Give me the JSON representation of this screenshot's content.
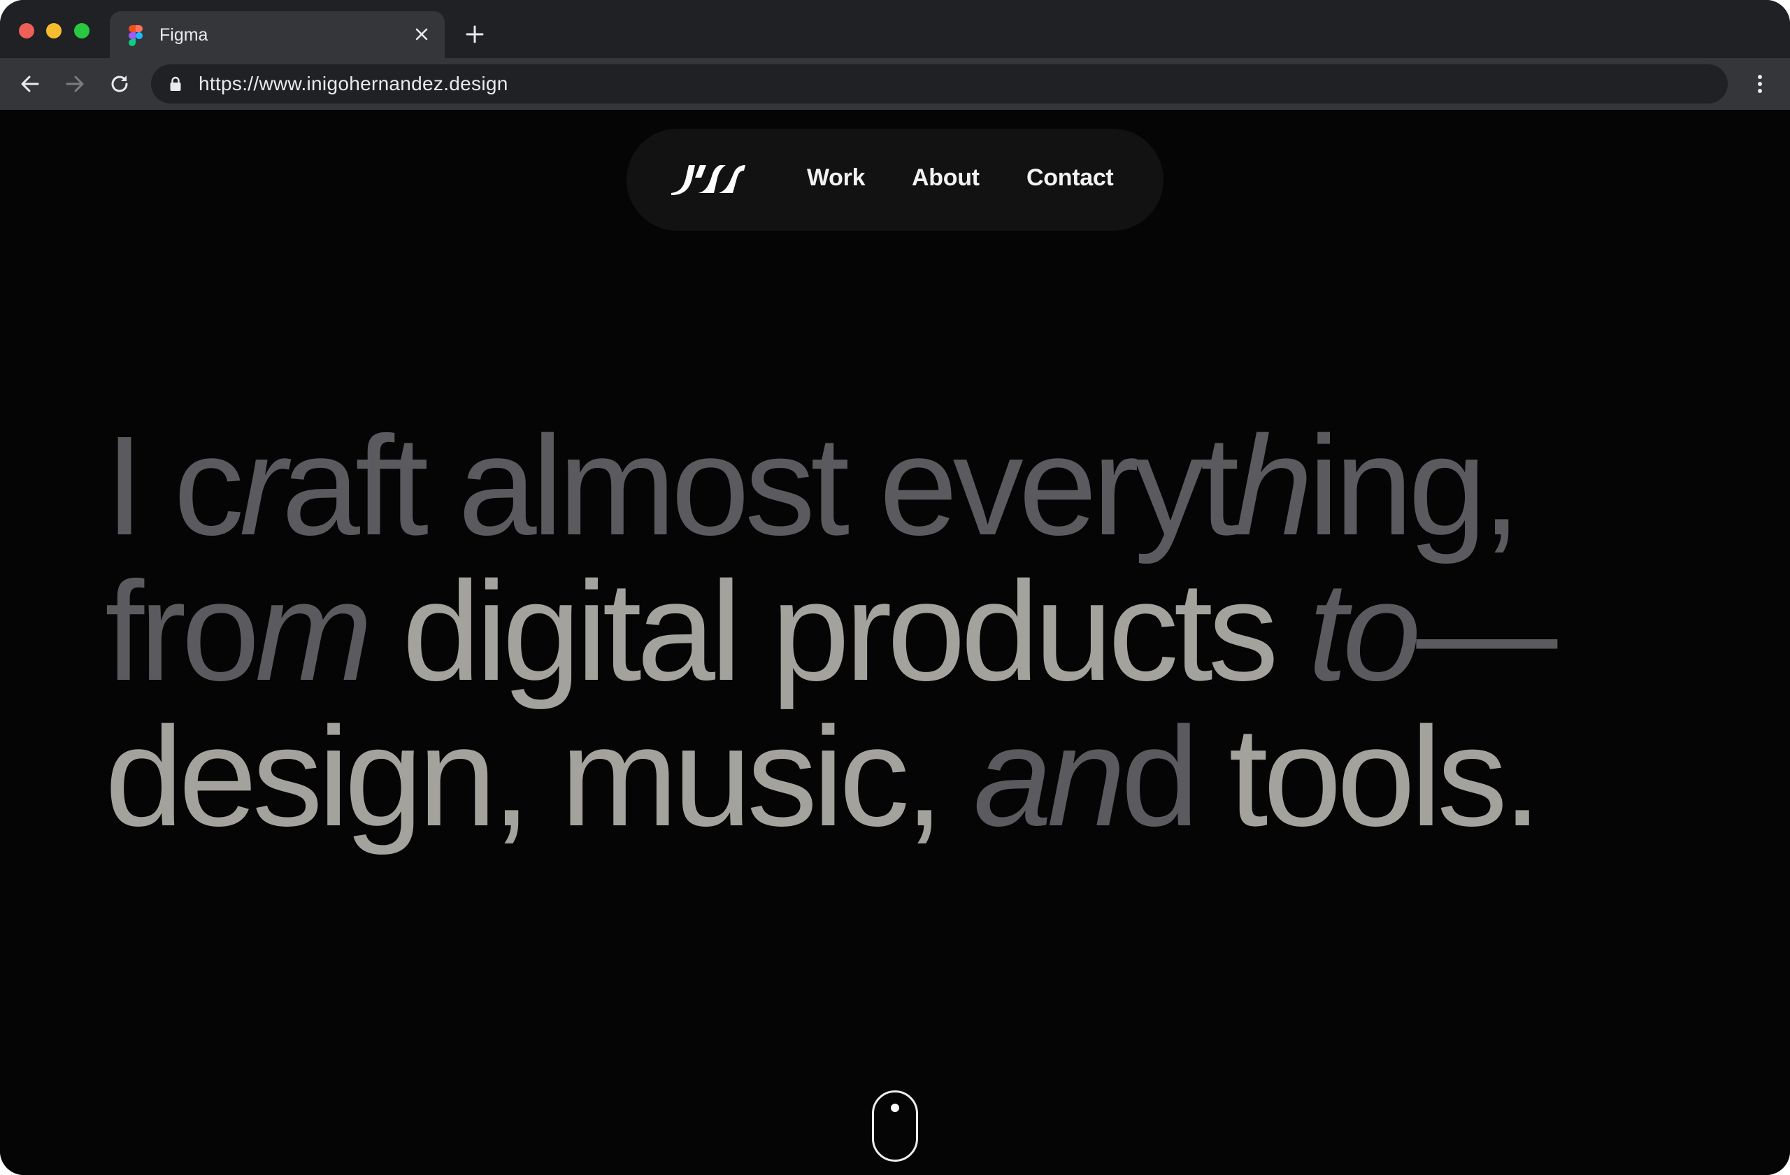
{
  "browser": {
    "tab": {
      "title": "Figma",
      "favicon": "figma-icon"
    },
    "url": "https://www.inigohernandez.design",
    "icons": {
      "back": "arrow-left-icon",
      "forward": "arrow-right-icon",
      "reload": "reload-icon",
      "lock": "lock-icon",
      "menu": "more-vertical-icon",
      "new_tab": "plus-icon",
      "close_tab": "close-icon"
    }
  },
  "site": {
    "logo": "IH logo",
    "nav": [
      {
        "label": "Work"
      },
      {
        "label": "About"
      },
      {
        "label": "Contact"
      }
    ],
    "hero": {
      "line1": [
        {
          "t": "I ",
          "tone": "gray"
        },
        {
          "t": "c",
          "tone": "gray"
        },
        {
          "t": "r",
          "tone": "gray",
          "italic": true
        },
        {
          "t": "aft almost everyt",
          "tone": "gray"
        },
        {
          "t": "h",
          "tone": "gray",
          "italic": true
        },
        {
          "t": "ing,",
          "tone": "gray"
        }
      ],
      "line2": [
        {
          "t": "fro",
          "tone": "gray"
        },
        {
          "t": "m",
          "tone": "gray",
          "italic": true
        },
        {
          "t": " digital products ",
          "tone": "light"
        },
        {
          "t": "to",
          "tone": "gray",
          "italic": true
        },
        {
          "t": "—",
          "tone": "gray"
        }
      ],
      "line3": [
        {
          "t": "design, music, ",
          "tone": "light"
        },
        {
          "t": "a",
          "tone": "gray",
          "italic": true
        },
        {
          "t": "n",
          "tone": "gray",
          "italic": true
        },
        {
          "t": "d",
          "tone": "gray"
        },
        {
          "t": " tools.",
          "tone": "light"
        }
      ]
    },
    "scroll_indicator": "mouse-scroll-icon"
  },
  "colors": {
    "page_bg": "#050505",
    "nav_bg": "#121212",
    "text_gray": "#5b5a5e",
    "text_light": "#a3a29c",
    "nav_text": "#f2f2f2"
  }
}
